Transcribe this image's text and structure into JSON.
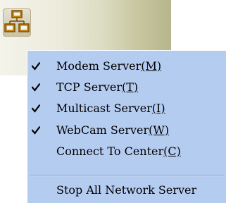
{
  "tray": {
    "icon_name": "network-servers-icon",
    "colors": {
      "icon_outline": "#7a4a00",
      "icon_fill": "#f0a000"
    }
  },
  "menu": {
    "background": "#b5ccf1",
    "items": [
      {
        "label": "Modem Server",
        "mnemonic": "(M)",
        "checked": true
      },
      {
        "label": "TCP Server",
        "mnemonic": "(T)",
        "checked": true
      },
      {
        "label": "Multicast Server",
        "mnemonic": "(I)",
        "checked": true
      },
      {
        "label": "WebCam Server",
        "mnemonic": "(W)",
        "checked": true
      },
      {
        "label": "Connect To Center",
        "mnemonic": "(C)",
        "checked": false
      }
    ],
    "bottom_item": {
      "label": "Stop All Network Server"
    }
  }
}
